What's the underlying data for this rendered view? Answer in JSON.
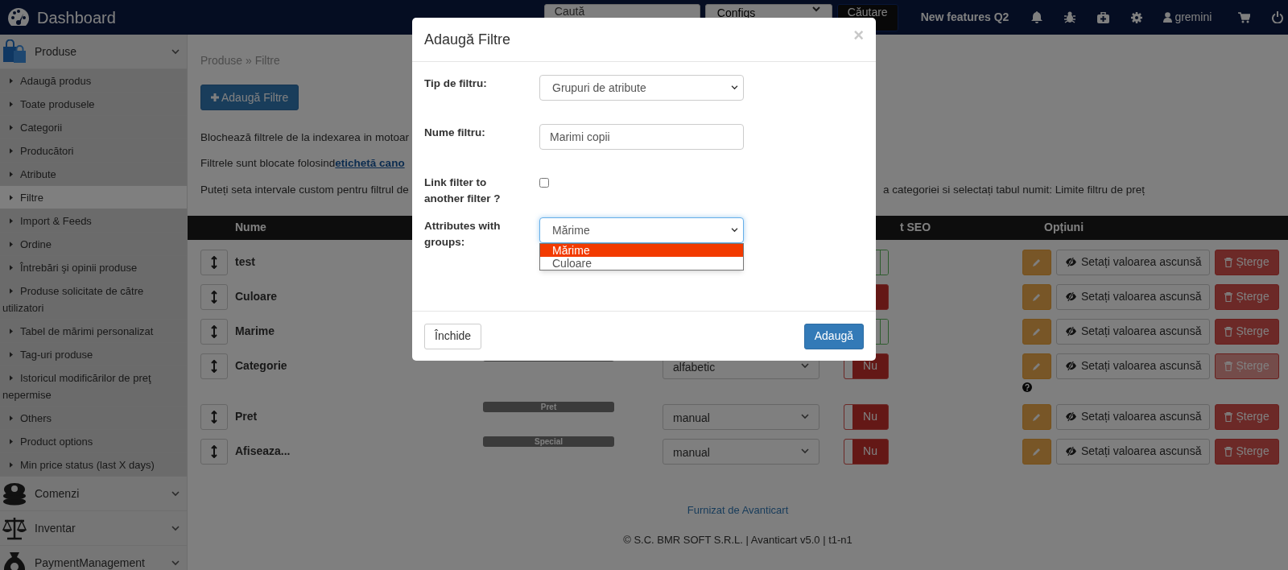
{
  "header": {
    "title": "Dashboard",
    "search": {
      "placeholder": "Caută"
    },
    "config_select": "Configs",
    "search_button": "Căutare",
    "new_features": "New features Q2",
    "user": "gremini"
  },
  "sidebar": {
    "sections": [
      {
        "kind": "bags",
        "label": "Produse",
        "items": [
          {
            "label": "Adaugă produs",
            "selected": false
          },
          {
            "label": "Toate produsele",
            "selected": false
          },
          {
            "label": "Categorii",
            "selected": false
          },
          {
            "label": "Producători",
            "selected": false
          },
          {
            "label": "Atribute",
            "selected": false
          },
          {
            "label": "Filtre",
            "selected": true
          },
          {
            "label": "Import & Feeds",
            "selected": false
          },
          {
            "label": "Ordine",
            "selected": false
          },
          {
            "label": "Întrebări şi opinii produse",
            "selected": false
          },
          {
            "label": "Produse solicitate de către utilizatori",
            "selected": false
          },
          {
            "label": "Tabel de mărimi personalizat",
            "selected": false
          },
          {
            "label": "Tag-uri produse",
            "selected": false
          },
          {
            "label": "Istoricul modificărilor de preţ nepermise",
            "selected": false
          },
          {
            "label": "Others",
            "selected": false
          },
          {
            "label": "Product options",
            "selected": false
          },
          {
            "label": "Min price status (last X days)",
            "selected": false
          }
        ]
      },
      {
        "kind": "coins",
        "label": "Comenzi"
      },
      {
        "kind": "scale",
        "label": "Inventar"
      },
      {
        "kind": "moneybag",
        "label": "PaymentManagement"
      }
    ]
  },
  "breadcrumb": "Produse » Filtre",
  "add_button": "Adaugă Filtre",
  "notes": [
    {
      "text": "Blochează filtrele de la indexarea in motoar"
    },
    {
      "text": "Filtrele sunt blocate folosind ",
      "link": "etichetă cano"
    },
    {
      "text": "Puteți seta intervale custom pentru filtrul de",
      "tail": "a categoriei si selectați tabul numit: Limite filtru de preț"
    }
  ],
  "table": {
    "columns": [
      {
        "label": "Nume"
      },
      {
        "label": "t SEO"
      },
      {
        "label": "Opțiuni"
      }
    ],
    "rows": [
      {
        "name": "test",
        "seo": {
          "on": true
        },
        "hide_label": "Setați valoarea ascunsă",
        "delete_label": "Șterge",
        "delete_disabled": false,
        "help": false
      },
      {
        "name": "Culoare",
        "seo": {
          "on": false
        },
        "hide_label": "Setați valoarea ascunsă",
        "delete_label": "Șterge",
        "delete_disabled": false,
        "help": false
      },
      {
        "name": "Marime",
        "seo": {
          "on": true
        },
        "hide_label": "Setați valoarea ascunsă",
        "delete_label": "Șterge",
        "delete_disabled": false,
        "help": false
      },
      {
        "name": "Categorie",
        "order": "alfabetic",
        "seo": {
          "on": false,
          "label": "Nu"
        },
        "hide_label": "Setați valoarea ascunsă",
        "delete_label": "Șterge",
        "delete_disabled": true,
        "help": true
      },
      {
        "name": "Pret",
        "badge": "Pret",
        "order": "manual",
        "seo": {
          "on": false,
          "label": "Nu"
        },
        "hide_label": "Setați valoarea ascunsă",
        "delete_label": "Șterge",
        "delete_disabled": false,
        "help": false
      },
      {
        "name": "Afiseaza...",
        "badge": "Special",
        "order": "manual",
        "seo": {
          "on": false,
          "label": "Nu"
        },
        "hide_label": "Setați valoarea ascunsă",
        "delete_label": "Șterge",
        "delete_disabled": false,
        "help": false
      }
    ]
  },
  "footer": {
    "link": "Furnizat de Avanticart",
    "copyright": "© S.C. BMR SOFT S.R.L. | Avanticart v5.0 | t1-n1"
  },
  "modal": {
    "title": "Adaugă Filtre",
    "close": "×",
    "fields": [
      {
        "kind": "select",
        "label": "Tip de filtru:",
        "value": "Grupuri de atribute"
      },
      {
        "kind": "text",
        "label": "Nume filtru:",
        "value": "Marimi copii"
      },
      {
        "kind": "checkbox",
        "label": "Link filter to another filter ?",
        "checked": false
      },
      {
        "kind": "select",
        "label": "Attributes with groups:",
        "value": "Mărime",
        "options": [
          {
            "label": "Mărime",
            "selected": true
          },
          {
            "label": "Culoare",
            "selected": false
          }
        ]
      }
    ],
    "cancel_button": "Închide",
    "submit_button": "Adaugă"
  }
}
